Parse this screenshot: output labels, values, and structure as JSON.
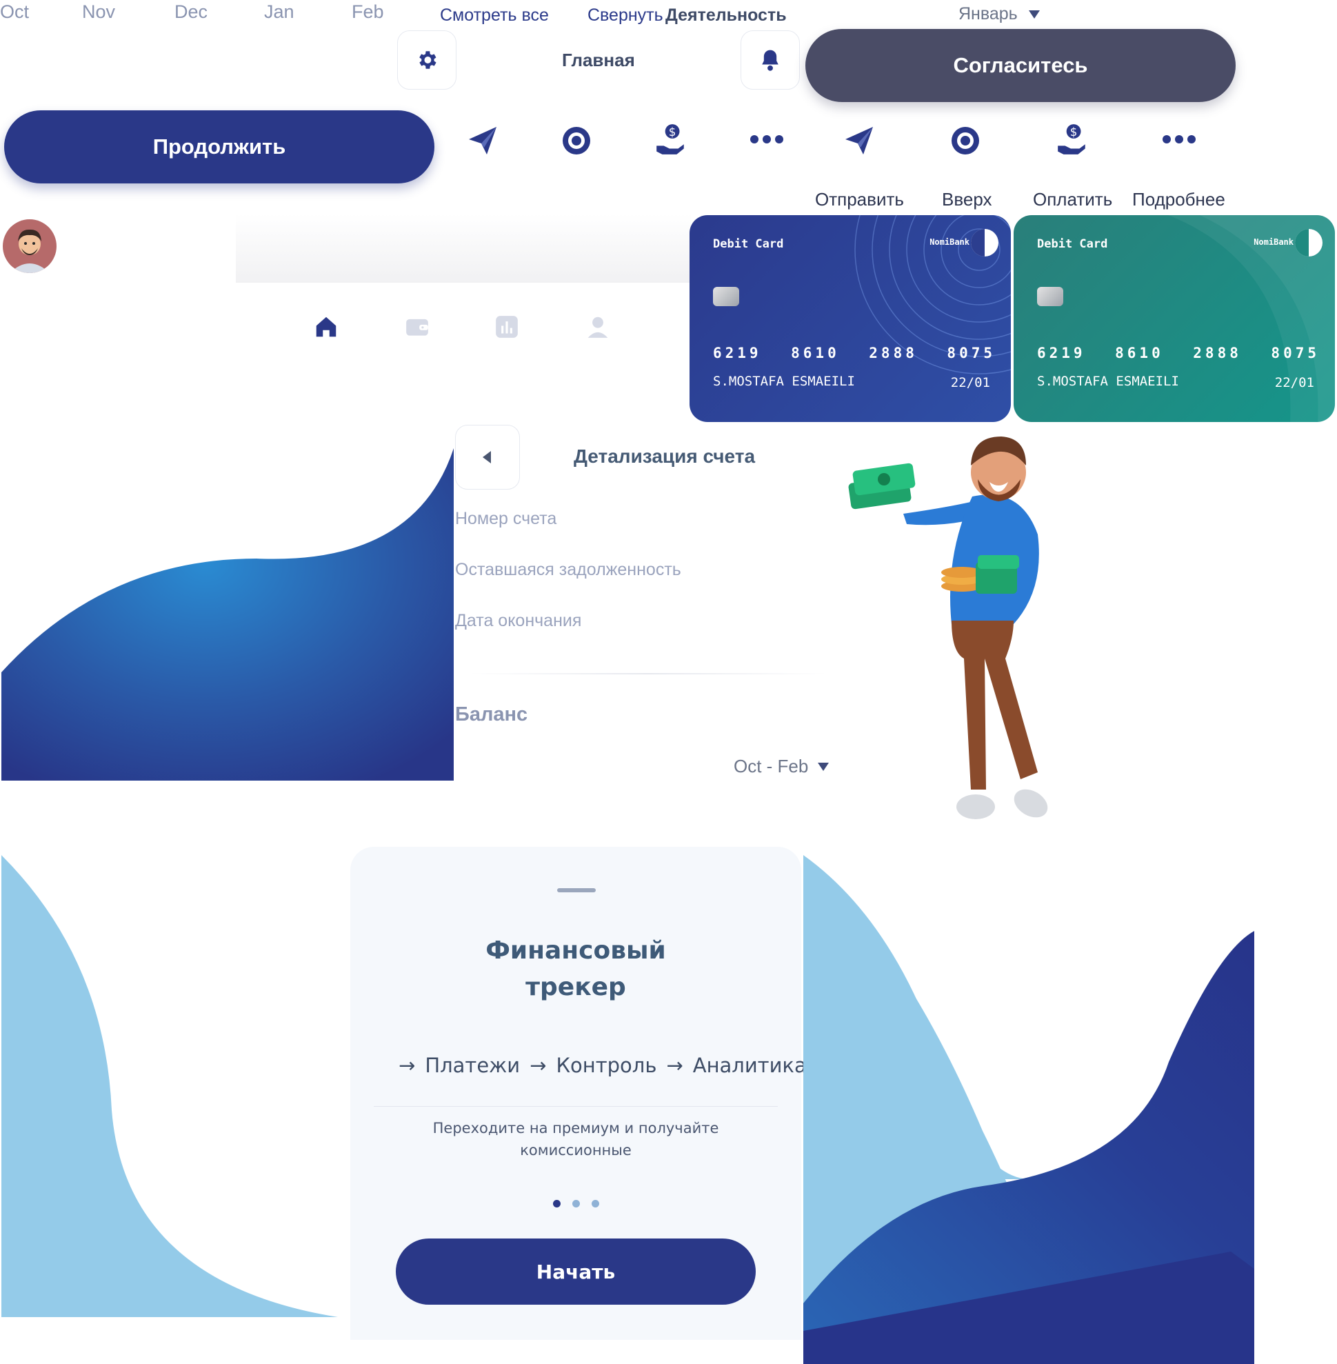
{
  "months": [
    "Oct",
    "Nov",
    "Dec",
    "Jan",
    "Feb"
  ],
  "links": {
    "view_all": "Смотреть все",
    "collapse": "Свернуть",
    "activity": "Деятельность"
  },
  "month_select": {
    "value": "Январь"
  },
  "header": {
    "title": "Главная"
  },
  "buttons": {
    "agree": "Согласитесь",
    "continue": "Продолжить",
    "start": "Начать"
  },
  "actions": [
    {
      "label": "Отправить",
      "icon": "send-icon"
    },
    {
      "label": "Вверх",
      "icon": "badge-icon"
    },
    {
      "label": "Оплатить",
      "icon": "pay-icon"
    },
    {
      "label": "Подробнее",
      "icon": "more-icon"
    }
  ],
  "cards": [
    {
      "type": "Debit Card",
      "bank": "NomiBank",
      "number": [
        "6219",
        "8610",
        "2888",
        "8075"
      ],
      "holder": "S.MOSTAFA ESMAEILI",
      "expiry": "22/01",
      "color": "#2c3e8f"
    },
    {
      "type": "Debit Card",
      "bank": "NomiBank",
      "number": [
        "6219",
        "8610",
        "2888",
        "8075"
      ],
      "holder": "S.MOSTAFA ESMAEILI",
      "expiry": "22/01",
      "color": "#1f8a80"
    }
  ],
  "bottom_nav": [
    "home-icon",
    "wallet-icon",
    "chart-icon",
    "profile-icon"
  ],
  "account_details": {
    "title": "Детализация счета",
    "fields": [
      "Номер счета",
      "Оставшаяся задолженность",
      "Дата окончания"
    ],
    "balance_label": "Баланс",
    "period": "Oct - Feb"
  },
  "onboarding": {
    "title_line1": "Финансовый",
    "title_line2": "трекер",
    "steps": [
      "Платежи",
      "Контроль",
      "Аналитика"
    ],
    "description_line1": "Переходите на премиум и получайте",
    "description_line2": "комиссионные"
  },
  "colors": {
    "primary": "#2a3888",
    "dark_pill": "#4a4c66",
    "teal": "#1f8a80",
    "light_blue": "#94cbe9",
    "muted": "#8a94b0"
  }
}
